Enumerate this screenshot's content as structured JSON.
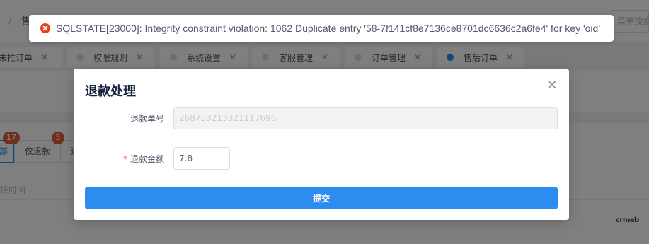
{
  "header": {
    "title_fragment": "售",
    "menu_search_placeholder": "菜单搜索"
  },
  "tabs": [
    {
      "label": "未推订单",
      "active": false
    },
    {
      "label": "权限规则",
      "active": false
    },
    {
      "label": "系统设置",
      "active": false
    },
    {
      "label": "客服管理",
      "active": false
    },
    {
      "label": "订单管理",
      "active": false
    },
    {
      "label": "售后订单",
      "active": true
    }
  ],
  "filters": {
    "badge_first": "17",
    "badge_second": "5",
    "button_first_fragment": "部",
    "button_refund_only": "仅退款",
    "button_third_fragment": "退",
    "time_label_fragment": "择时间"
  },
  "modal": {
    "title": "退款处理",
    "close_symbol": "✕",
    "refund_no_label": "退款单号",
    "refund_no_value": "268753213321117696",
    "amount_label": "退款金额",
    "required_mark": "*",
    "amount_value": "7.8",
    "submit_label": "提交"
  },
  "toast": {
    "type": "error",
    "message": "SQLSTATE[23000]: Integrity constraint violation: 1062 Duplicate entry '58-7f141cf8e7136ce8701dc6636c2a6fe4' for key 'oid'"
  },
  "brand": {
    "text": "crmeb"
  },
  "colors": {
    "primary": "#2d8cf0",
    "error": "#ed4014",
    "badge": "#e35b3a",
    "active_dot": "#1890ff"
  }
}
